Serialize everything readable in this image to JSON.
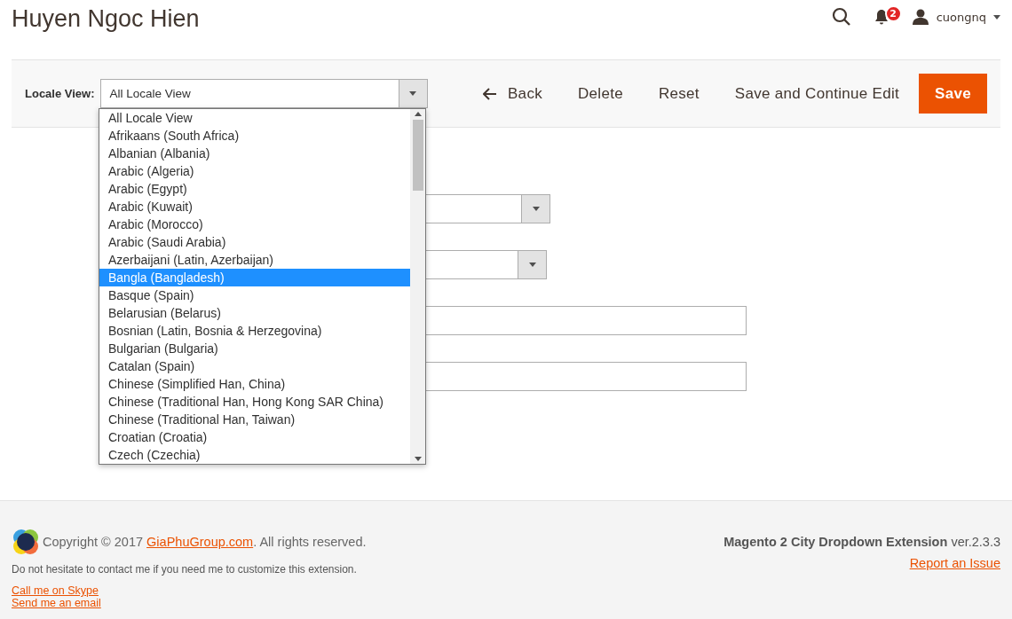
{
  "page_title": "Huyen Ngoc Hien",
  "header": {
    "notification_count": "2",
    "username": "cuongnq"
  },
  "toolbar": {
    "locale_label": "Locale View:",
    "locale_value": "All Locale View",
    "buttons": [
      {
        "kind": "back",
        "label": "Back"
      },
      {
        "kind": "plain",
        "label": "Delete"
      },
      {
        "kind": "plain",
        "label": "Reset"
      },
      {
        "kind": "plain",
        "label": "Save and Continue Edit"
      },
      {
        "kind": "primary",
        "label": "Save"
      }
    ]
  },
  "locale_options": [
    {
      "label": "All Locale View",
      "selected": false
    },
    {
      "label": "Afrikaans (South Africa)",
      "selected": false
    },
    {
      "label": "Albanian (Albania)",
      "selected": false
    },
    {
      "label": "Arabic (Algeria)",
      "selected": false
    },
    {
      "label": "Arabic (Egypt)",
      "selected": false
    },
    {
      "label": "Arabic (Kuwait)",
      "selected": false
    },
    {
      "label": "Arabic (Morocco)",
      "selected": false
    },
    {
      "label": "Arabic (Saudi Arabia)",
      "selected": false
    },
    {
      "label": "Azerbaijani (Latin, Azerbaijan)",
      "selected": false
    },
    {
      "label": "Bangla (Bangladesh)",
      "selected": true
    },
    {
      "label": "Basque (Spain)",
      "selected": false
    },
    {
      "label": "Belarusian (Belarus)",
      "selected": false
    },
    {
      "label": "Bosnian (Latin, Bosnia & Herzegovina)",
      "selected": false
    },
    {
      "label": "Bulgarian (Bulgaria)",
      "selected": false
    },
    {
      "label": "Catalan (Spain)",
      "selected": false
    },
    {
      "label": "Chinese (Simplified Han, China)",
      "selected": false
    },
    {
      "label": "Chinese (Traditional Han, Hong Kong SAR China)",
      "selected": false
    },
    {
      "label": "Chinese (Traditional Han, Taiwan)",
      "selected": false
    },
    {
      "label": "Croatian (Croatia)",
      "selected": false
    },
    {
      "label": "Czech (Czechia)",
      "selected": false
    }
  ],
  "form_fields": [
    {
      "kind": "select"
    },
    {
      "kind": "select"
    },
    {
      "kind": "input"
    },
    {
      "kind": "input"
    }
  ],
  "footer": {
    "copyright_before": "Copyright © 2017 ",
    "copyright_link": "GiaPhuGroup.com",
    "copyright_after": ". All rights reserved.",
    "contact_note": "Do not hesitate to contact me if you need me to customize this extension.",
    "links": [
      "Call me on Skype",
      "Send me an email"
    ],
    "product_name": "Magento 2 City Dropdown Extension",
    "version": "ver.2.3.3",
    "report_link": "Report an Issue"
  }
}
